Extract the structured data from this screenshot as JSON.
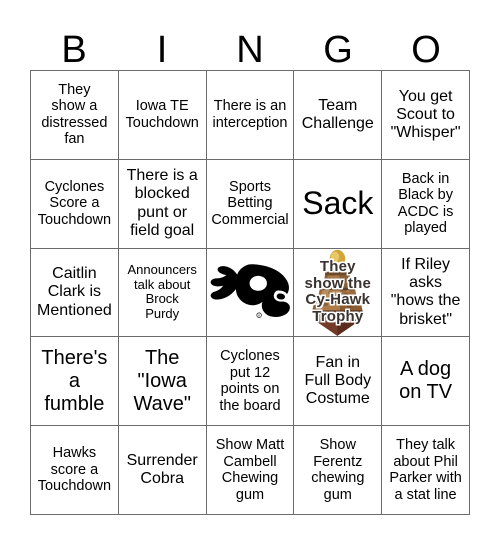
{
  "header": {
    "letters": [
      "B",
      "I",
      "N",
      "G",
      "O"
    ]
  },
  "grid": {
    "rows": 5,
    "columns": 5,
    "line_color": "#6b6b6b",
    "background": "#ffffff",
    "text_color": "#000000"
  },
  "cells": [
    {
      "id": "b1",
      "column": "B",
      "row": 1,
      "type": "text",
      "text": "They\nshow a\ndistressed\nfan",
      "size": "fs-sm"
    },
    {
      "id": "i1",
      "column": "I",
      "row": 1,
      "type": "text",
      "text": "Iowa TE\nTouchdown",
      "size": "fs-sm"
    },
    {
      "id": "n1",
      "column": "N",
      "row": 1,
      "type": "text",
      "text": "There is an\ninterception",
      "size": "fs-sm"
    },
    {
      "id": "g1",
      "column": "G",
      "row": 1,
      "type": "text",
      "text": "Team\nChallenge",
      "size": "fs-md"
    },
    {
      "id": "o1",
      "column": "O",
      "row": 1,
      "type": "text",
      "text": "You get\nScout to\n\"Whisper\"",
      "size": "fs-md"
    },
    {
      "id": "b2",
      "column": "B",
      "row": 2,
      "type": "text",
      "text": "Cyclones\nScore a\nTouchdown",
      "size": "fs-sm"
    },
    {
      "id": "i2",
      "column": "I",
      "row": 2,
      "type": "text",
      "text": "There is a\nblocked\npunt or\nfield goal",
      "size": "fs-md"
    },
    {
      "id": "n2",
      "column": "N",
      "row": 2,
      "type": "text",
      "text": "Sports\nBetting\nCommercial",
      "size": "fs-sm"
    },
    {
      "id": "g2",
      "column": "G",
      "row": 2,
      "type": "text",
      "text": "Sack",
      "size": "fs-xl"
    },
    {
      "id": "o2",
      "column": "O",
      "row": 2,
      "type": "text",
      "text": "Back in\nBlack by\nACDC is\nplayed",
      "size": "fs-sm"
    },
    {
      "id": "b3",
      "column": "B",
      "row": 3,
      "type": "text",
      "text": "Caitlin\nClark is\nMentioned",
      "size": "fs-md"
    },
    {
      "id": "i3",
      "column": "I",
      "row": 3,
      "type": "text",
      "text": "Announcers\ntalk about\nBrock\nPurdy",
      "size": "fs-xs"
    },
    {
      "id": "n3",
      "column": "N",
      "row": 3,
      "type": "image",
      "image": "iowa-hawkeyes-tigerhawk-logo",
      "text": ""
    },
    {
      "id": "g3",
      "column": "G",
      "row": 3,
      "type": "image-caption",
      "image": "cy-hawk-trophy-photo",
      "text": "They\nshow the\nCy-Hawk\nTrophy"
    },
    {
      "id": "o3",
      "column": "O",
      "row": 3,
      "type": "text",
      "text": "If Riley\nasks\n\"hows the\nbrisket\"",
      "size": "fs-md"
    },
    {
      "id": "b4",
      "column": "B",
      "row": 4,
      "type": "text",
      "text": "There's\na\nfumble",
      "size": "fs-lg"
    },
    {
      "id": "i4",
      "column": "I",
      "row": 4,
      "type": "text",
      "text": "The\n\"Iowa\nWave\"",
      "size": "fs-lg"
    },
    {
      "id": "n4",
      "column": "N",
      "row": 4,
      "type": "text",
      "text": "Cyclones\nput 12\npoints on\nthe board",
      "size": "fs-sm"
    },
    {
      "id": "g4",
      "column": "G",
      "row": 4,
      "type": "text",
      "text": "Fan in\nFull Body\nCostume",
      "size": "fs-md"
    },
    {
      "id": "o4",
      "column": "O",
      "row": 4,
      "type": "text",
      "text": "A dog\non TV",
      "size": "fs-lg"
    },
    {
      "id": "b5",
      "column": "B",
      "row": 5,
      "type": "text",
      "text": "Hawks\nscore a\nTouchdown",
      "size": "fs-sm"
    },
    {
      "id": "i5",
      "column": "I",
      "row": 5,
      "type": "text",
      "text": "Surrender\nCobra",
      "size": "fs-md"
    },
    {
      "id": "n5",
      "column": "N",
      "row": 5,
      "type": "text",
      "text": "Show Matt\nCambell\nChewing\ngum",
      "size": "fs-sm"
    },
    {
      "id": "g5",
      "column": "G",
      "row": 5,
      "type": "text",
      "text": "Show\nFerentz\nchewing\ngum",
      "size": "fs-sm"
    },
    {
      "id": "o5",
      "column": "O",
      "row": 5,
      "type": "text",
      "text": "They talk\nabout Phil\nParker with\na stat line",
      "size": "fs-sm"
    }
  ],
  "colors": {
    "trophy_gold": "#c9a227",
    "trophy_bronze": "#8a5a32",
    "trophy_tan": "#b9norm",
    "trophy_dark": "#5a3420",
    "trophy_base": "#6b2d22",
    "logo_black": "#000000",
    "caption_stroke": "#ffffff"
  }
}
